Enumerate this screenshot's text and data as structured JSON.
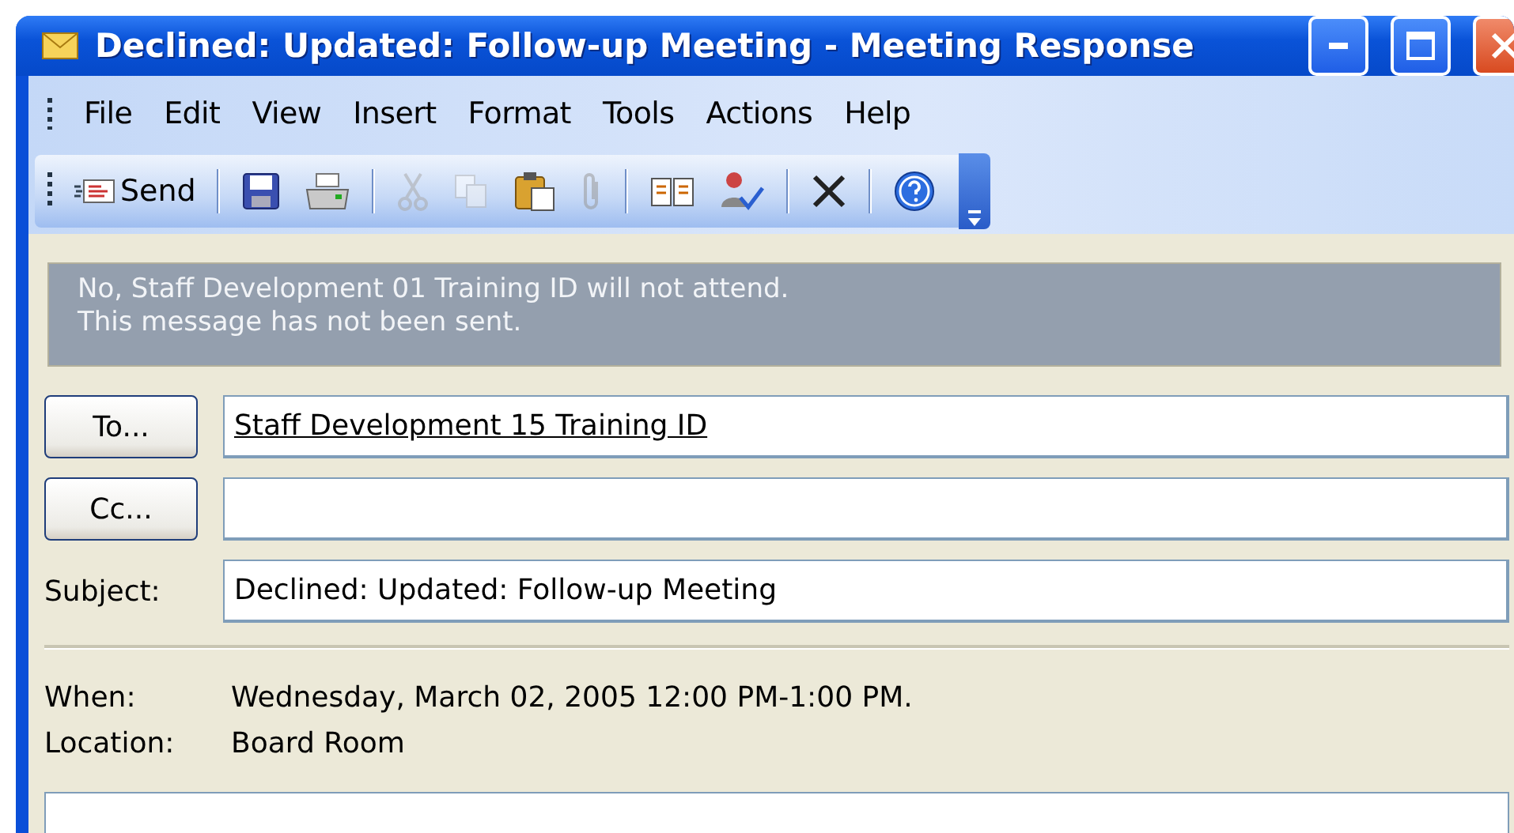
{
  "window": {
    "title": "Declined: Updated: Follow-up Meeting - Meeting Response"
  },
  "menu": [
    "File",
    "Edit",
    "View",
    "Insert",
    "Format",
    "Tools",
    "Actions",
    "Help"
  ],
  "toolbar": [
    {
      "kind": "button",
      "label": "Send",
      "disabled": false
    },
    {
      "kind": "separator"
    },
    {
      "kind": "icon",
      "disabled": false
    },
    {
      "kind": "icon",
      "disabled": false
    },
    {
      "kind": "separator"
    },
    {
      "kind": "icon",
      "disabled": true
    },
    {
      "kind": "icon",
      "disabled": true
    },
    {
      "kind": "icon",
      "disabled": false
    },
    {
      "kind": "icon",
      "disabled": true
    },
    {
      "kind": "separator"
    },
    {
      "kind": "icon",
      "disabled": false
    },
    {
      "kind": "icon",
      "disabled": false
    },
    {
      "kind": "separator"
    },
    {
      "kind": "icon",
      "disabled": false
    },
    {
      "kind": "separator"
    },
    {
      "kind": "icon",
      "disabled": false
    }
  ],
  "info_bar": [
    "No, Staff Development 01 Training ID will not attend.",
    "This message has not been sent."
  ],
  "recipients": [
    {
      "button": "To...",
      "value": "Staff Development 15 Training ID"
    },
    {
      "button": "Cc..."
    }
  ],
  "subject": {
    "label": "Subject:",
    "value": "Declined: Updated: Follow-up Meeting"
  },
  "details": [
    {
      "label": "When:",
      "value": "Wednesday, March 02, 2005 12:00 PM-1:00 PM."
    },
    {
      "label": "Location:",
      "value": "Board Room"
    }
  ]
}
